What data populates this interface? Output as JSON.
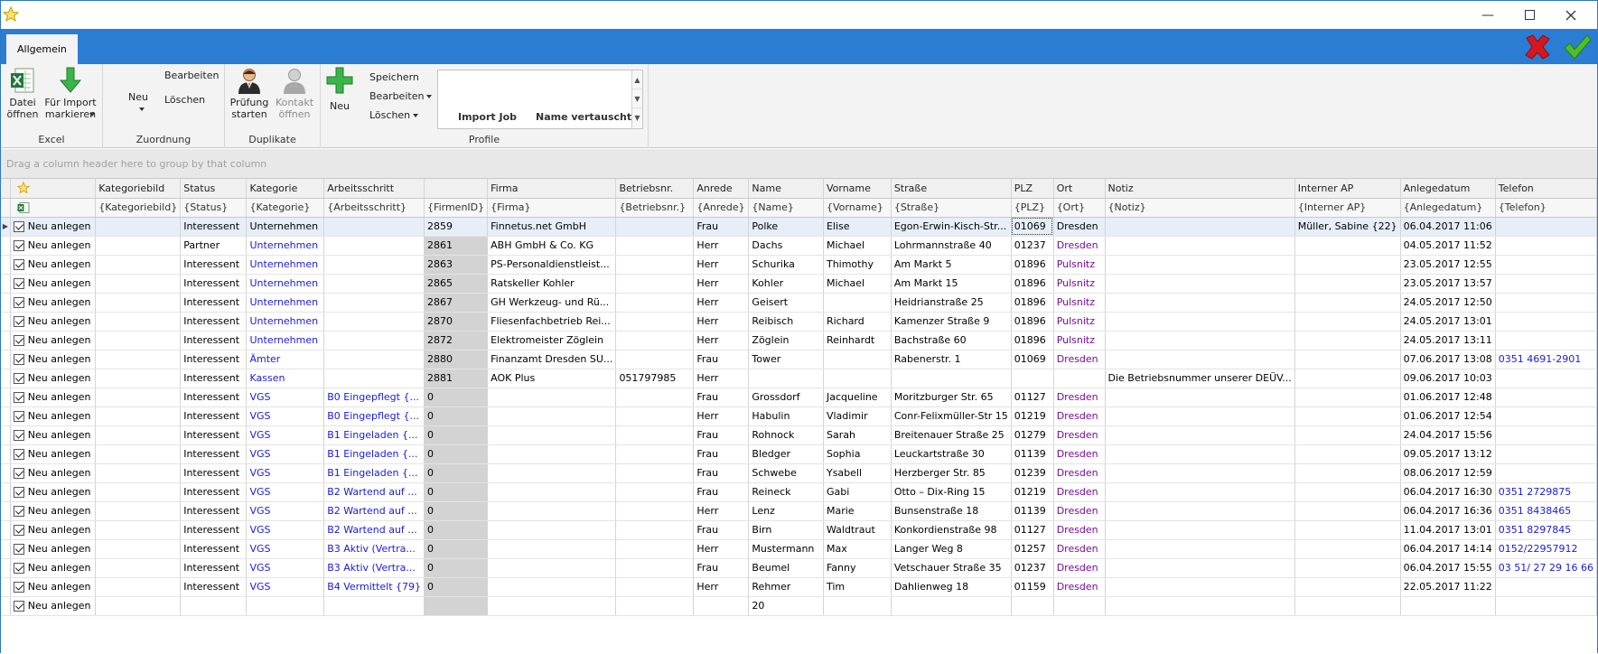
{
  "ribbon": {
    "tab": "Allgemein",
    "groups": {
      "excel": {
        "label": "Excel",
        "open_file": "Datei öffnen",
        "mark_import": "Für Import markieren"
      },
      "assignment": {
        "label": "Zuordnung",
        "new": "Neu",
        "edit": "Bearbeiten",
        "delete": "Löschen"
      },
      "duplicates": {
        "label": "Duplikate",
        "check_start": "Prüfung starten",
        "contact_open": "Kontakt öffnen"
      },
      "profiles": {
        "label": "Profile",
        "new": "Neu",
        "save": "Speichern",
        "edit": "Bearbeiten",
        "delete": "Löschen",
        "gallery_items": [
          "Import Job",
          "Name vertauscht"
        ]
      }
    }
  },
  "group_panel_hint": "Drag a column header here to group by that column",
  "columns": [
    "Kategoriebild",
    "Status",
    "Kategorie",
    "Arbeitsschritt",
    "",
    "Firma",
    "Betriebsnr.",
    "Anrede",
    "Name",
    "Vorname",
    "Straße",
    "PLZ",
    "Ort",
    "Notiz",
    "Interner AP",
    "Anlegedatum",
    "Telefon"
  ],
  "filters": [
    "{Kategoriebild}",
    "{Status}",
    "{Kategorie}",
    "{Arbeitsschritt}",
    "{FirmenID}",
    "{Firma}",
    "{Betriebsnr.}",
    "{Anrede}",
    "{Name}",
    "{Vorname}",
    "{Straße}",
    "{PLZ}",
    "{Ort}",
    "{Notiz}",
    "{Interner AP}",
    "{Anlegedatum}",
    "{Telefon}"
  ],
  "rows": [
    {
      "action": "Neu anlegen",
      "status": "Interessent",
      "kategorie": "Unternehmen",
      "schritt": "",
      "fid": "2859",
      "firma": "Finnetus.net GmbH",
      "betr": "",
      "anrede": "Frau",
      "name": "Polke",
      "vorname": "Elise",
      "strasse": "Egon-Erwin-Kisch-Str...",
      "plz": "01069",
      "ort": "Dresden",
      "notiz": "",
      "ap": "Müller, Sabine {22}",
      "datum": "06.04.2017 11:06",
      "tel": ""
    },
    {
      "action": "Neu anlegen",
      "status": "Partner",
      "kategorie": "Unternehmen",
      "schritt": "",
      "fid": "2861",
      "firma": "ABH GmbH & Co. KG",
      "betr": "",
      "anrede": "Herr",
      "name": "Dachs",
      "vorname": "Michael",
      "strasse": "Lohrmannstraße 40",
      "plz": "01237",
      "ort": "Dresden",
      "notiz": "",
      "ap": "",
      "datum": "04.05.2017 11:52",
      "tel": ""
    },
    {
      "action": "Neu anlegen",
      "status": "Interessent",
      "kategorie": "Unternehmen",
      "schritt": "",
      "fid": "2863",
      "firma": "PS-Personaldienstleist...",
      "betr": "",
      "anrede": "Herr",
      "name": "Schurika",
      "vorname": "Thimothy",
      "strasse": "Am Markt 5",
      "plz": "01896",
      "ort": "Pulsnitz",
      "notiz": "",
      "ap": "",
      "datum": "23.05.2017 12:55",
      "tel": ""
    },
    {
      "action": "Neu anlegen",
      "status": "Interessent",
      "kategorie": "Unternehmen",
      "schritt": "",
      "fid": "2865",
      "firma": "Ratskeller Kohler",
      "betr": "",
      "anrede": "Herr",
      "name": "Kohler",
      "vorname": "Michael",
      "strasse": "Am Markt 15",
      "plz": "01896",
      "ort": "Pulsnitz",
      "notiz": "",
      "ap": "",
      "datum": "23.05.2017 13:57",
      "tel": ""
    },
    {
      "action": "Neu anlegen",
      "status": "Interessent",
      "kategorie": "Unternehmen",
      "schritt": "",
      "fid": "2867",
      "firma": "GH Werkzeug- und Rü...",
      "betr": "",
      "anrede": "Herr",
      "name": "Geisert",
      "vorname": "",
      "strasse": "Heidrianstraße 25",
      "plz": "01896",
      "ort": "Pulsnitz",
      "notiz": "",
      "ap": "",
      "datum": "24.05.2017 12:50",
      "tel": ""
    },
    {
      "action": "Neu anlegen",
      "status": "Interessent",
      "kategorie": "Unternehmen",
      "schritt": "",
      "fid": "2870",
      "firma": "Fliesenfachbetrieb Rei...",
      "betr": "",
      "anrede": "Herr",
      "name": "Reibisch",
      "vorname": "Richard",
      "strasse": "Kamenzer Straße 9",
      "plz": "01896",
      "ort": "Pulsnitz",
      "notiz": "",
      "ap": "",
      "datum": "24.05.2017 13:01",
      "tel": ""
    },
    {
      "action": "Neu anlegen",
      "status": "Interessent",
      "kategorie": "Unternehmen",
      "schritt": "",
      "fid": "2872",
      "firma": "Elektromeister Zöglein",
      "betr": "",
      "anrede": "Herr",
      "name": "Zöglein",
      "vorname": "Reinhardt",
      "strasse": "Bachstraße 60",
      "plz": "01896",
      "ort": "Pulsnitz",
      "notiz": "",
      "ap": "",
      "datum": "24.05.2017 13:11",
      "tel": ""
    },
    {
      "action": "Neu anlegen",
      "status": "Interessent",
      "kategorie": "Ämter",
      "schritt": "",
      "fid": "2880",
      "firma": "Finanzamt Dresden SU...",
      "betr": "",
      "anrede": "Frau",
      "name": "Tower",
      "vorname": "",
      "strasse": "Rabenerstr. 1",
      "plz": "01069",
      "ort": "Dresden",
      "notiz": "",
      "ap": "",
      "datum": "07.06.2017 13:08",
      "tel": "0351 4691-2901"
    },
    {
      "action": "Neu anlegen",
      "status": "Interessent",
      "kategorie": "Kassen",
      "schritt": "",
      "fid": "2881",
      "firma": "AOK Plus",
      "betr": "051797985",
      "anrede": "Herr",
      "name": "",
      "vorname": "",
      "strasse": "",
      "plz": "",
      "ort": "",
      "notiz": "Die Betriebsnummer unserer DEÜV...",
      "ap": "",
      "datum": "09.06.2017 10:03",
      "tel": ""
    },
    {
      "action": "Neu anlegen",
      "status": "Interessent",
      "kategorie": "VGS",
      "schritt": "B0 Eingepflegt {...",
      "fid": "0",
      "firma": "",
      "betr": "",
      "anrede": "Frau",
      "name": "Grossdorf",
      "vorname": "Jacqueline",
      "strasse": "Moritzburger Str. 65",
      "plz": "01127",
      "ort": "Dresden",
      "notiz": "",
      "ap": "",
      "datum": "01.06.2017 12:48",
      "tel": ""
    },
    {
      "action": "Neu anlegen",
      "status": "Interessent",
      "kategorie": "VGS",
      "schritt": "B0 Eingepflegt {...",
      "fid": "0",
      "firma": "",
      "betr": "",
      "anrede": "Herr",
      "name": "Habulin",
      "vorname": "Vladimir",
      "strasse": "Conr-Felixmüller-Str 15",
      "plz": "01219",
      "ort": "Dresden",
      "notiz": "",
      "ap": "",
      "datum": "01.06.2017 12:54",
      "tel": ""
    },
    {
      "action": "Neu anlegen",
      "status": "Interessent",
      "kategorie": "VGS",
      "schritt": "B1 Eingeladen {...",
      "fid": "0",
      "firma": "",
      "betr": "",
      "anrede": "Frau",
      "name": "Rohnock",
      "vorname": "Sarah",
      "strasse": "Breitenauer Straße 25",
      "plz": "01279",
      "ort": "Dresden",
      "notiz": "",
      "ap": "",
      "datum": "24.04.2017 15:56",
      "tel": ""
    },
    {
      "action": "Neu anlegen",
      "status": "Interessent",
      "kategorie": "VGS",
      "schritt": "B1 Eingeladen {...",
      "fid": "0",
      "firma": "",
      "betr": "",
      "anrede": "Frau",
      "name": "Bledger",
      "vorname": "Sophia",
      "strasse": "Leuckartstraße 30",
      "plz": "01139",
      "ort": "Dresden",
      "notiz": "",
      "ap": "",
      "datum": "09.05.2017 13:12",
      "tel": ""
    },
    {
      "action": "Neu anlegen",
      "status": "Interessent",
      "kategorie": "VGS",
      "schritt": "B1 Eingeladen {...",
      "fid": "0",
      "firma": "",
      "betr": "",
      "anrede": "Frau",
      "name": "Schwebe",
      "vorname": "Ysabell",
      "strasse": "Herzberger Str. 85",
      "plz": "01239",
      "ort": "Dresden",
      "notiz": "",
      "ap": "",
      "datum": "08.06.2017 12:59",
      "tel": ""
    },
    {
      "action": "Neu anlegen",
      "status": "Interessent",
      "kategorie": "VGS",
      "schritt": "B2 Wartend auf ...",
      "fid": "0",
      "firma": "",
      "betr": "",
      "anrede": "Frau",
      "name": "Reineck",
      "vorname": "Gabi",
      "strasse": "Otto – Dix-Ring 15",
      "plz": "01219",
      "ort": "Dresden",
      "notiz": "",
      "ap": "",
      "datum": "06.04.2017 16:30",
      "tel": "0351 2729875"
    },
    {
      "action": "Neu anlegen",
      "status": "Interessent",
      "kategorie": "VGS",
      "schritt": "B2 Wartend auf ...",
      "fid": "0",
      "firma": "",
      "betr": "",
      "anrede": "Herr",
      "name": "Lenz",
      "vorname": "Marie",
      "strasse": "Bunsenstraße 18",
      "plz": "01139",
      "ort": "Dresden",
      "notiz": "",
      "ap": "",
      "datum": "06.04.2017 16:36",
      "tel": "0351 8438465"
    },
    {
      "action": "Neu anlegen",
      "status": "Interessent",
      "kategorie": "VGS",
      "schritt": "B2 Wartend auf ...",
      "fid": "0",
      "firma": "",
      "betr": "",
      "anrede": "Frau",
      "name": "Birn",
      "vorname": "Waldtraut",
      "strasse": "Konkordienstraße 98",
      "plz": "01127",
      "ort": "Dresden",
      "notiz": "",
      "ap": "",
      "datum": "11.04.2017 13:01",
      "tel": "0351 8297845"
    },
    {
      "action": "Neu anlegen",
      "status": "Interessent",
      "kategorie": "VGS",
      "schritt": "B3 Aktiv (Vertra...",
      "fid": "0",
      "firma": "",
      "betr": "",
      "anrede": "Herr",
      "name": "Mustermann",
      "vorname": "Max",
      "strasse": "Langer Weg 8",
      "plz": "01257",
      "ort": "Dresden",
      "notiz": "",
      "ap": "",
      "datum": "06.04.2017 14:14",
      "tel": "0152/22957912"
    },
    {
      "action": "Neu anlegen",
      "status": "Interessent",
      "kategorie": "VGS",
      "schritt": "B3 Aktiv (Vertra...",
      "fid": "0",
      "firma": "",
      "betr": "",
      "anrede": "Frau",
      "name": "Beumel",
      "vorname": "Fanny",
      "strasse": "Vetschauer Straße 35",
      "plz": "01237",
      "ort": "Dresden",
      "notiz": "",
      "ap": "",
      "datum": "06.04.2017 15:55",
      "tel": "03 51/ 27 29 16 66"
    },
    {
      "action": "Neu anlegen",
      "status": "Interessent",
      "kategorie": "VGS",
      "schritt": "B4 Vermittelt {79}",
      "fid": "0",
      "firma": "",
      "betr": "",
      "anrede": "Herr",
      "name": "Rehmer",
      "vorname": "Tim",
      "strasse": "Dahlienweg 18",
      "plz": "01159",
      "ort": "Dresden",
      "notiz": "",
      "ap": "",
      "datum": "22.05.2017 11:22",
      "tel": ""
    },
    {
      "action": "Neu anlegen",
      "status": "",
      "kategorie": "",
      "schritt": "",
      "fid": "",
      "firma": "",
      "betr": "",
      "anrede": "",
      "name": "20",
      "vorname": "",
      "strasse": "",
      "plz": "",
      "ort": "",
      "notiz": "",
      "ap": "",
      "datum": "",
      "tel": ""
    }
  ],
  "colors": {
    "ribbon_blue": "#2b7cd3",
    "link_blue": "#1a1adf",
    "city_purple": "#7a0a9a"
  }
}
